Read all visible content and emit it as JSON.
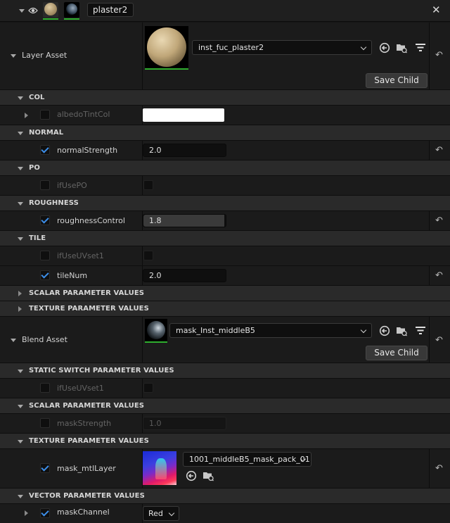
{
  "header": {
    "layer_name": "plaster2",
    "close_glyph": "✕"
  },
  "layer_asset": {
    "label": "Layer Asset",
    "selected": "inst_fuc_plaster2",
    "save_child": "Save Child"
  },
  "groups": {
    "col": {
      "title": "COL",
      "albedo_label": "albedoTintCol",
      "albedo_color": "#ffffff"
    },
    "normal": {
      "title": "NORMAL",
      "strength_label": "normalStrength",
      "strength_value": "2.0"
    },
    "po": {
      "title": "PO",
      "use_label": "ifUsePO"
    },
    "roughness": {
      "title": "ROUGHNESS",
      "control_label": "roughnessControl",
      "control_value": "1.8",
      "control_fill": 0.98
    },
    "tile": {
      "title": "TILE",
      "uv_label": "ifUseUVset1",
      "num_label": "tileNum",
      "num_value": "2.0"
    },
    "scalar": {
      "title": "SCALAR PARAMETER VALUES"
    },
    "texture": {
      "title": "TEXTURE PARAMETER VALUES"
    }
  },
  "blend_asset": {
    "label": "Blend Asset",
    "selected": "mask_Inst_middleB5",
    "save_child": "Save Child",
    "static_switch": {
      "title": "STATIC SWITCH PARAMETER VALUES",
      "uv_label": "ifUseUVset1"
    },
    "scalar": {
      "title": "SCALAR PARAMETER VALUES",
      "mask_label": "maskStrength",
      "mask_value": "1.0"
    },
    "texture": {
      "title": "TEXTURE PARAMETER VALUES",
      "layer_label": "mask_mtlLayer",
      "layer_value": "1001_middleB5_mask_pack_01"
    },
    "vector": {
      "title": "VECTOR PARAMETER VALUES",
      "channel_label": "maskChannel",
      "channel_value": "Red"
    }
  },
  "icons": {
    "reset": "↶",
    "colors": {
      "accent_check": "#3d8ee8",
      "thumb_ok": "#2fae2f"
    }
  }
}
